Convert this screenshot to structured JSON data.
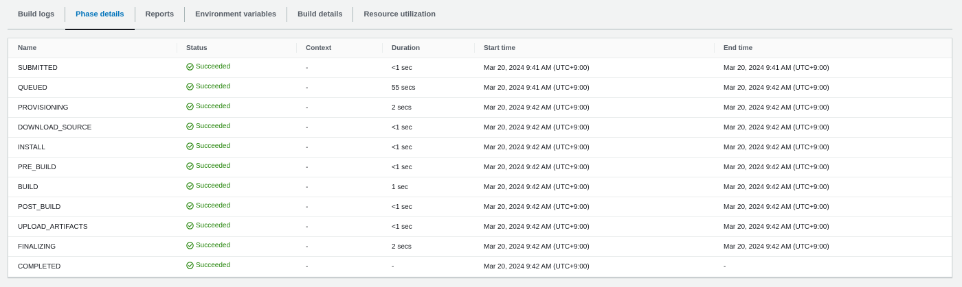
{
  "tabs": [
    {
      "label": "Build logs",
      "active": false
    },
    {
      "label": "Phase details",
      "active": true
    },
    {
      "label": "Reports",
      "active": false
    },
    {
      "label": "Environment variables",
      "active": false
    },
    {
      "label": "Build details",
      "active": false
    },
    {
      "label": "Resource utilization",
      "active": false
    }
  ],
  "colors": {
    "accent": "#0073bb",
    "success": "#1d8102"
  },
  "table": {
    "headers": [
      "Name",
      "Status",
      "Context",
      "Duration",
      "Start time",
      "End time"
    ],
    "rows": [
      {
        "name": "SUBMITTED",
        "status": "Succeeded",
        "context": "-",
        "duration": "<1 sec",
        "start": "Mar 20, 2024 9:41 AM (UTC+9:00)",
        "end": "Mar 20, 2024 9:41 AM (UTC+9:00)"
      },
      {
        "name": "QUEUED",
        "status": "Succeeded",
        "context": "-",
        "duration": "55 secs",
        "start": "Mar 20, 2024 9:41 AM (UTC+9:00)",
        "end": "Mar 20, 2024 9:42 AM (UTC+9:00)"
      },
      {
        "name": "PROVISIONING",
        "status": "Succeeded",
        "context": "-",
        "duration": "2 secs",
        "start": "Mar 20, 2024 9:42 AM (UTC+9:00)",
        "end": "Mar 20, 2024 9:42 AM (UTC+9:00)"
      },
      {
        "name": "DOWNLOAD_SOURCE",
        "status": "Succeeded",
        "context": "-",
        "duration": "<1 sec",
        "start": "Mar 20, 2024 9:42 AM (UTC+9:00)",
        "end": "Mar 20, 2024 9:42 AM (UTC+9:00)"
      },
      {
        "name": "INSTALL",
        "status": "Succeeded",
        "context": "-",
        "duration": "<1 sec",
        "start": "Mar 20, 2024 9:42 AM (UTC+9:00)",
        "end": "Mar 20, 2024 9:42 AM (UTC+9:00)"
      },
      {
        "name": "PRE_BUILD",
        "status": "Succeeded",
        "context": "-",
        "duration": "<1 sec",
        "start": "Mar 20, 2024 9:42 AM (UTC+9:00)",
        "end": "Mar 20, 2024 9:42 AM (UTC+9:00)"
      },
      {
        "name": "BUILD",
        "status": "Succeeded",
        "context": "-",
        "duration": "1 sec",
        "start": "Mar 20, 2024 9:42 AM (UTC+9:00)",
        "end": "Mar 20, 2024 9:42 AM (UTC+9:00)"
      },
      {
        "name": "POST_BUILD",
        "status": "Succeeded",
        "context": "-",
        "duration": "<1 sec",
        "start": "Mar 20, 2024 9:42 AM (UTC+9:00)",
        "end": "Mar 20, 2024 9:42 AM (UTC+9:00)"
      },
      {
        "name": "UPLOAD_ARTIFACTS",
        "status": "Succeeded",
        "context": "-",
        "duration": "<1 sec",
        "start": "Mar 20, 2024 9:42 AM (UTC+9:00)",
        "end": "Mar 20, 2024 9:42 AM (UTC+9:00)"
      },
      {
        "name": "FINALIZING",
        "status": "Succeeded",
        "context": "-",
        "duration": "2 secs",
        "start": "Mar 20, 2024 9:42 AM (UTC+9:00)",
        "end": "Mar 20, 2024 9:42 AM (UTC+9:00)"
      },
      {
        "name": "COMPLETED",
        "status": "Succeeded",
        "context": "-",
        "duration": "-",
        "start": "Mar 20, 2024 9:42 AM (UTC+9:00)",
        "end": "-"
      }
    ]
  }
}
